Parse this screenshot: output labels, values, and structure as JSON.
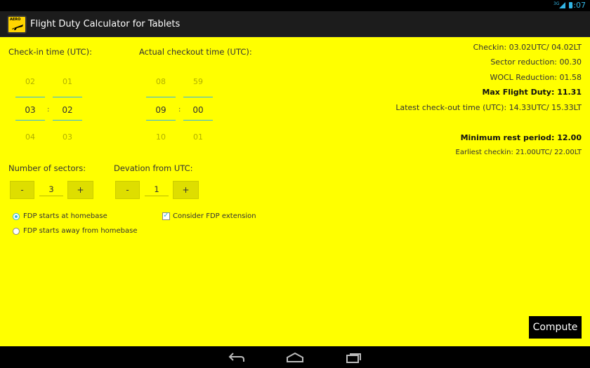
{
  "status": {
    "time": "3:07",
    "network": "3G"
  },
  "app": {
    "icon_text": "AERO",
    "title": "Flight Duty Calculator for Tablets"
  },
  "checkin": {
    "label": "Check-in time (UTC):",
    "hour": {
      "prev": "02",
      "value": "03",
      "next": "04"
    },
    "minute": {
      "prev": "01",
      "value": "02",
      "next": "03"
    },
    "separator": ":"
  },
  "checkout": {
    "label": "Actual checkout time (UTC):",
    "hour": {
      "prev": "08",
      "value": "09",
      "next": "10"
    },
    "minute": {
      "prev": "59",
      "value": "00",
      "next": "01"
    },
    "separator": ":"
  },
  "sectors": {
    "label": "Number of sectors:",
    "minus": "-",
    "value": "3",
    "plus": "+"
  },
  "deviation": {
    "label": "Devation from UTC:",
    "minus": "-",
    "value": "1",
    "plus": "+"
  },
  "options": {
    "fdp_home": {
      "label": "FDP starts at homebase",
      "checked": true
    },
    "fdp_away": {
      "label": "FDP starts away from homebase",
      "checked": false
    },
    "extension": {
      "label": "Consider FDP extension",
      "checked": true
    }
  },
  "results": {
    "checkin": "Checkin: 03.02UTC/ 04.02LT",
    "sector_reduction": "Sector reduction: 00.30",
    "wocl_reduction": "WOCL Reduction: 01.58",
    "max_flight_duty": "Max Flight Duty: 11.31",
    "latest_checkout": "Latest check-out time (UTC): 14.33UTC/ 15.33LT",
    "minimum_rest": "Minimum rest period: 12.00",
    "earliest_checkin": "Earliest checkin: 21.00UTC/ 22.00LT"
  },
  "compute_label": "Compute",
  "nav": {
    "back_icon": "back-icon",
    "home_icon": "home-icon",
    "recents_icon": "recents-icon"
  },
  "colors": {
    "background": "#ffff00",
    "accent": "#33b5e5",
    "title_bar": "#1c1c1c"
  }
}
